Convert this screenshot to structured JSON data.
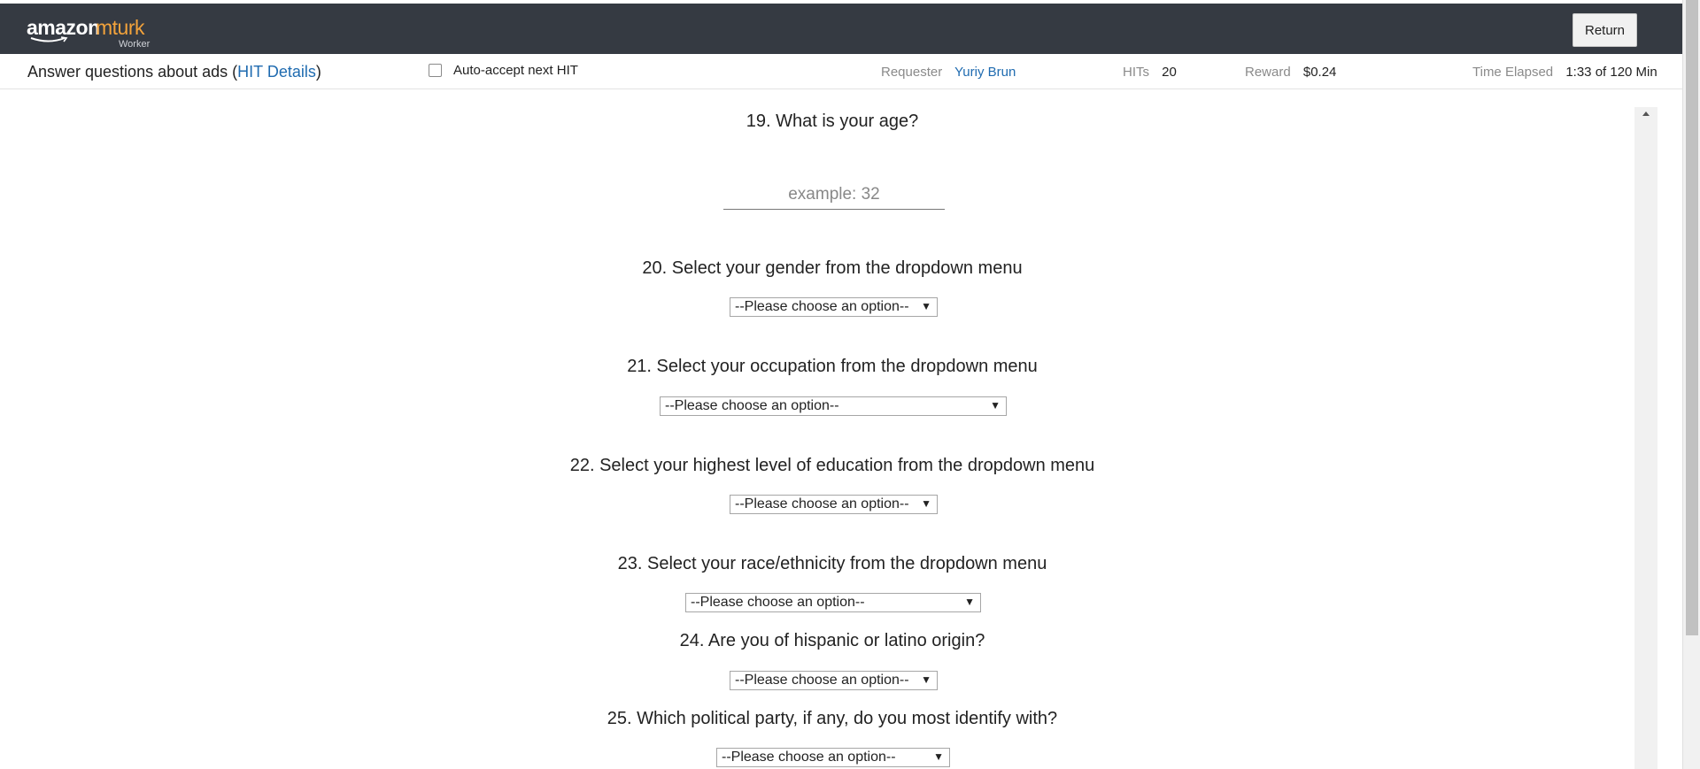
{
  "header": {
    "logo_amazon": "amazon",
    "logo_mturk": "mturk",
    "logo_sub": "Worker",
    "return_label": "Return"
  },
  "infobar": {
    "title": "Answer questions about ads",
    "details_link": "HIT Details",
    "auto_accept_label": "Auto-accept next HIT",
    "requester_key": "Requester",
    "requester_value": "Yuriy Brun",
    "hits_key": "HITs",
    "hits_value": "20",
    "reward_key": "Reward",
    "reward_value": "$0.24",
    "time_key": "Time Elapsed",
    "time_value": "1:33 of 120 Min"
  },
  "questions": {
    "q19": "19. What is your age?",
    "q19_placeholder": "example: 32",
    "q20": "20. Select your gender from the dropdown menu",
    "q21": "21. Select your occupation from the dropdown menu",
    "q22": "22. Select your highest level of education from the dropdown menu",
    "q23": "23. Select your race/ethnicity from the dropdown menu",
    "q24": "24. Are you of hispanic or latino origin?",
    "q25": "25. Which political party, if any, do you most identify with?",
    "select_default": "--Please choose an option--"
  },
  "icons": {
    "dropdown": "chevron-down-icon",
    "scroll_up": "scroll-up-icon"
  }
}
